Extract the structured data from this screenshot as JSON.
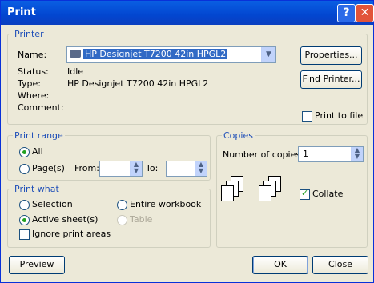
{
  "window": {
    "title": "Print",
    "help_btn": "?",
    "close_btn": "✕"
  },
  "printer": {
    "group_title": "Printer",
    "name_label": "Name:",
    "name_value": "HP Designjet T7200 42in HPGL2",
    "status_label": "Status:",
    "status_value": "Idle",
    "type_label": "Type:",
    "type_value": "HP Designjet T7200 42in HPGL2",
    "where_label": "Where:",
    "comment_label": "Comment:",
    "properties_btn": "Properties...",
    "find_printer_btn": "Find Printer...",
    "print_to_file_label": "Print to file",
    "print_to_file_checked": false
  },
  "print_range": {
    "group_title": "Print range",
    "all_label": "All",
    "pages_label": "Page(s)",
    "from_label": "From:",
    "to_label": "To:",
    "from_value": "",
    "to_value": "",
    "selected": "all"
  },
  "copies": {
    "group_title": "Copies",
    "number_label": "Number of copies:",
    "number_value": "1",
    "collate_label": "Collate",
    "collate_checked": true
  },
  "print_what": {
    "group_title": "Print what",
    "selection_label": "Selection",
    "entire_workbook_label": "Entire workbook",
    "active_sheets_label": "Active sheet(s)",
    "table_label": "Table",
    "ignore_areas_label": "Ignore print areas",
    "selected": "active_sheets"
  },
  "footer": {
    "preview_btn": "Preview",
    "ok_btn": "OK",
    "close_btn": "Close"
  }
}
